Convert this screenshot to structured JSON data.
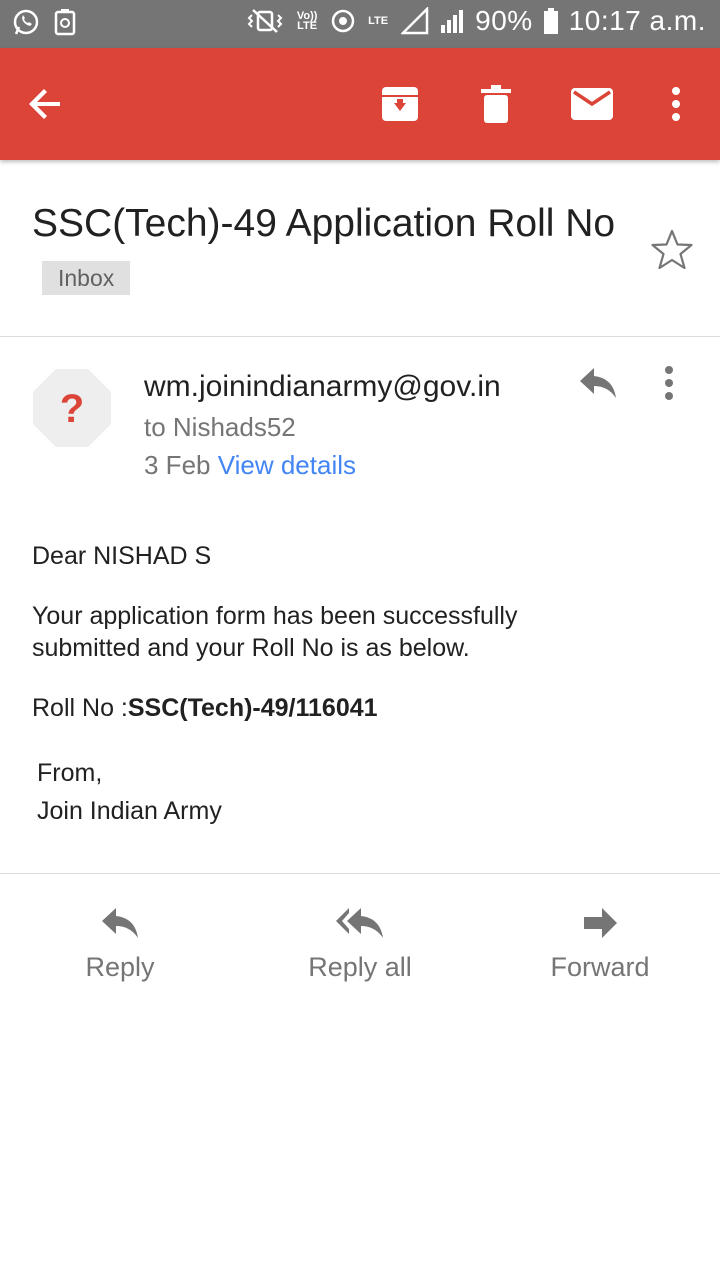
{
  "status_bar": {
    "battery": "90%",
    "time": "10:17 a.m.",
    "volte": "Vo)) LTE",
    "lte": "LTE"
  },
  "app_bar": {
    "back_icon": "arrow-back-icon",
    "actions": [
      "archive-icon",
      "delete-icon",
      "mark-unread-icon",
      "more-vert-icon"
    ],
    "color": "#db4437"
  },
  "email": {
    "subject": "SSC(Tech)-49 Application Roll No",
    "label": "Inbox",
    "sender": "wm.joinindianarmy@gov.in",
    "recipient": "to Nishads52",
    "date": "3 Feb",
    "view_details": "View details",
    "avatar_glyph": "?",
    "body": {
      "greeting": "Dear NISHAD S",
      "paragraph": "Your application form has been successfully submitted and your Roll No is as below.",
      "roll_label": "Roll No :",
      "roll_value": "SSC(Tech)-49/116041",
      "from_label": "From,",
      "from_name": "Join Indian Army"
    }
  },
  "actions": {
    "reply": "Reply",
    "reply_all": "Reply all",
    "forward": "Forward"
  }
}
